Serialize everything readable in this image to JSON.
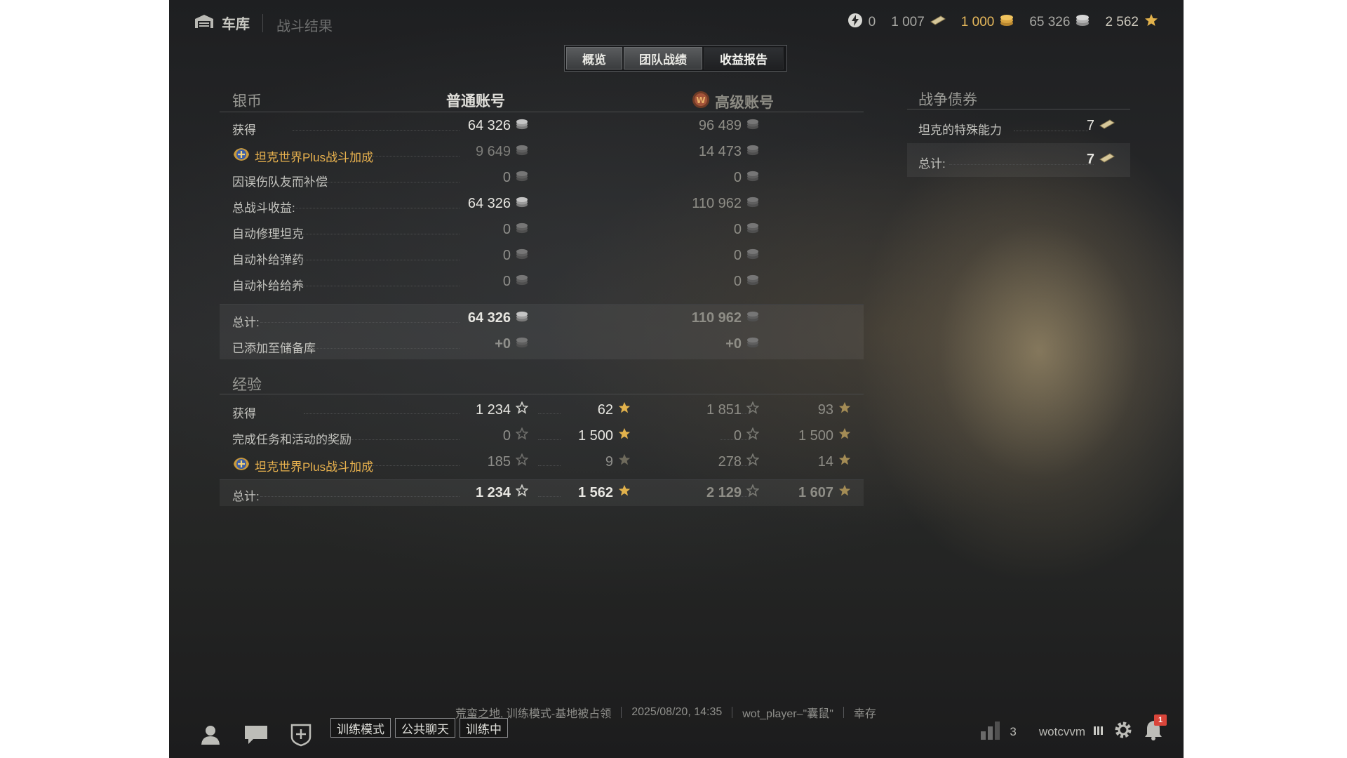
{
  "header": {
    "garage_label": "车库",
    "page_title": "战斗结果"
  },
  "currency": {
    "free_xp": "0",
    "bonds": "1 007",
    "gold": "1 000",
    "credits": "65 326",
    "xp": "2 562"
  },
  "tabs": [
    {
      "label": "概览",
      "selected": false
    },
    {
      "label": "团队战绩",
      "selected": false
    },
    {
      "label": "收益报告",
      "selected": true
    }
  ],
  "credits_section": {
    "title": "银币",
    "standard_header": "普通账号",
    "premium_header": "高级账号",
    "rows": [
      {
        "label": "获得",
        "standard": "64 326",
        "premium": "96 489",
        "gold_label": false
      },
      {
        "label": "坦克世界Plus战斗加成",
        "standard": "9 649",
        "premium": "14 473",
        "gold_label": true
      },
      {
        "label": "因误伤队友而补偿",
        "standard": "0",
        "premium": "0",
        "gold_label": false
      },
      {
        "label": "总战斗收益:",
        "standard": "64 326",
        "premium": "110 962",
        "gold_label": false
      },
      {
        "label": "自动修理坦克",
        "standard": "0",
        "premium": "0",
        "gold_label": false
      },
      {
        "label": "自动补给弹药",
        "standard": "0",
        "premium": "0",
        "gold_label": false
      },
      {
        "label": "自动补给给养",
        "standard": "0",
        "premium": "0",
        "gold_label": false
      }
    ],
    "total_rows": [
      {
        "label": "总计:",
        "standard": "64 326",
        "premium": "110 962"
      },
      {
        "label": "已添加至储备库",
        "standard": "+0",
        "premium": "+0"
      }
    ]
  },
  "xp_section": {
    "title": "经验",
    "rows": [
      {
        "label": "获得",
        "std_xp": "1 234",
        "std_free": "62",
        "prem_xp": "1 851",
        "prem_free": "93",
        "gold_label": false
      },
      {
        "label": "完成任务和活动的奖励",
        "std_xp": "0",
        "std_free": "1 500",
        "prem_xp": "0",
        "prem_free": "1 500",
        "gold_label": false
      },
      {
        "label": "坦克世界Plus战斗加成",
        "std_xp": "185",
        "std_free": "9",
        "prem_xp": "278",
        "prem_free": "14",
        "gold_label": true
      }
    ],
    "total": {
      "label": "总计:",
      "std_xp": "1 234",
      "std_free": "1 562",
      "prem_xp": "2 129",
      "prem_free": "1 607"
    }
  },
  "bonds_panel": {
    "title": "战争债券",
    "rows": [
      {
        "label": "坦克的特殊能力",
        "value": "7"
      }
    ],
    "total": {
      "label": "总计:",
      "value": "7"
    }
  },
  "footer": {
    "battle_map": "荒蛮之地, 训练模式-基地被占领",
    "battle_time": "2025/08/20, 14:35",
    "battle_player": "wot_player–\"囊鼠\"",
    "battle_status": "幸存",
    "buttons": [
      "训练模式",
      "公共聊天",
      "训练中"
    ],
    "online_count": "3",
    "username": "wotcvvm",
    "notification_count": "1"
  },
  "colors": {
    "gold": "#e6b85b",
    "text": "#c9c9c4",
    "background": "#252627"
  }
}
